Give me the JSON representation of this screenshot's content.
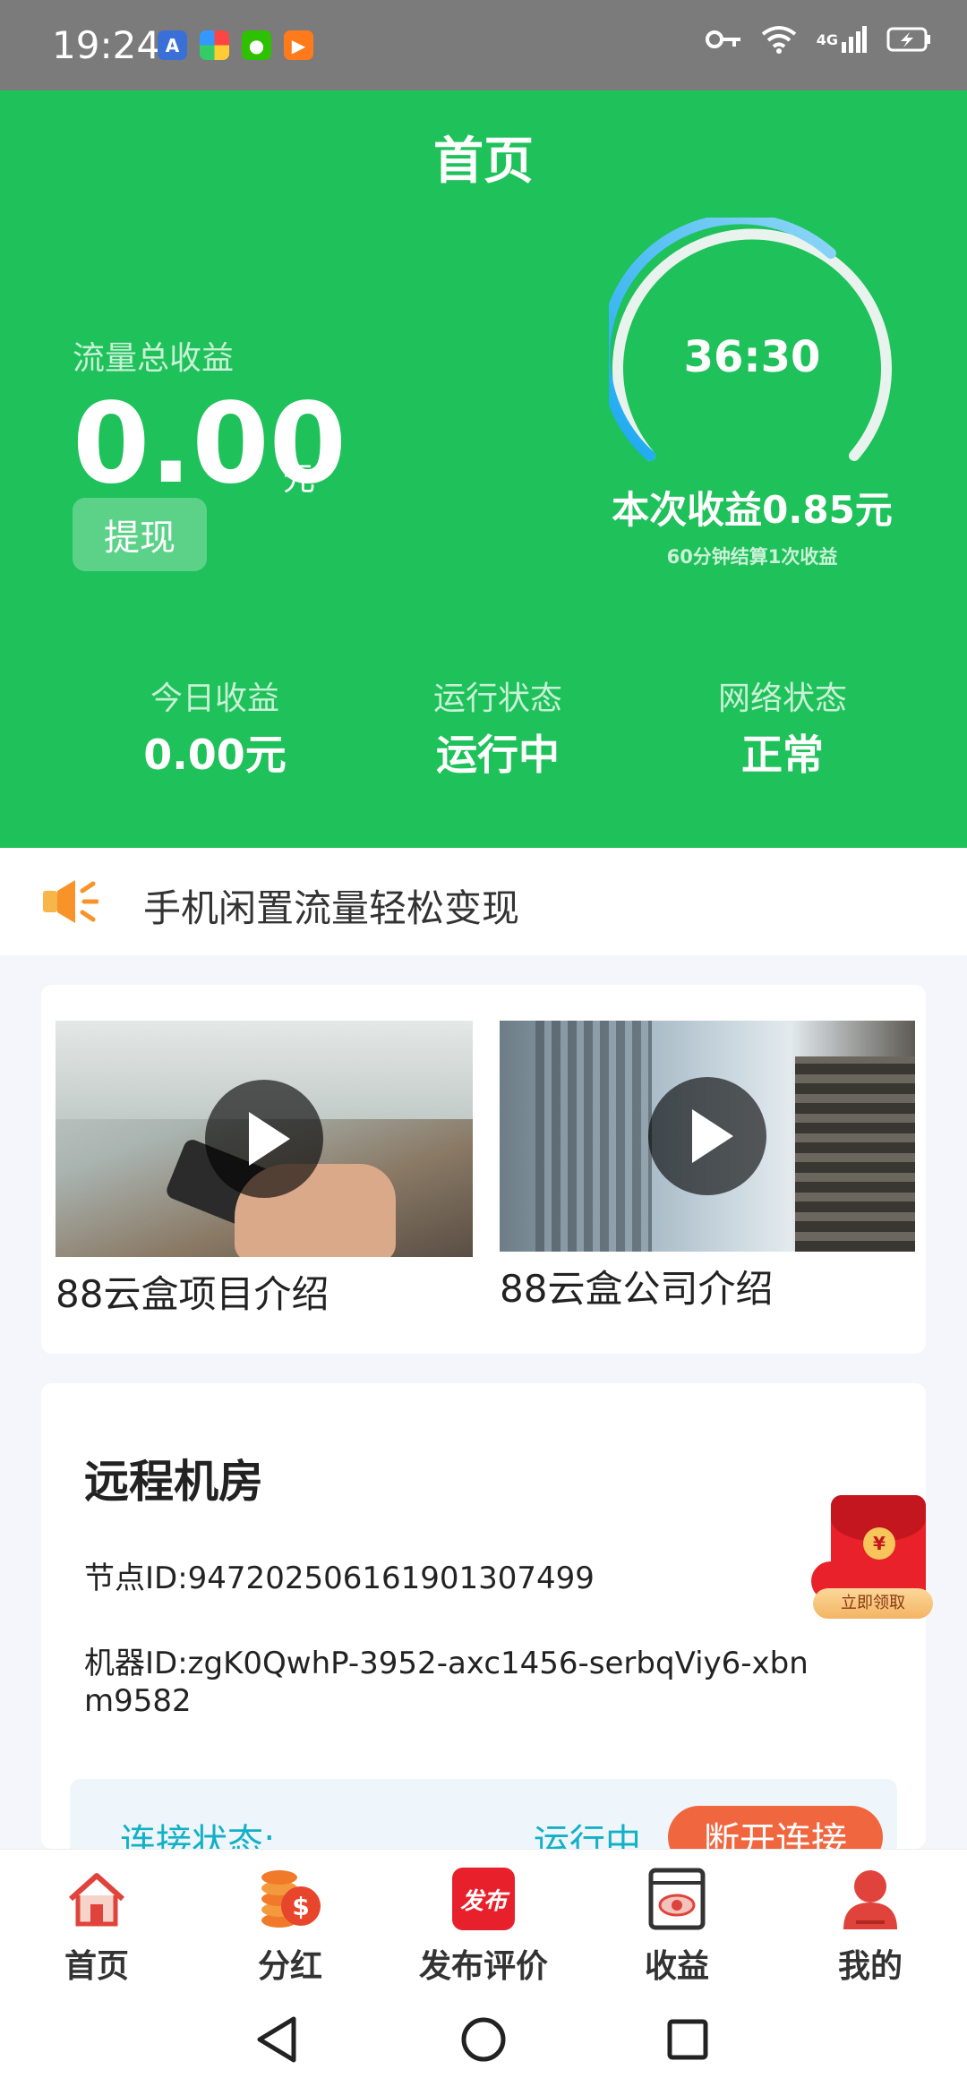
{
  "status_bar": {
    "time": "19:24",
    "network": "4G",
    "icons": [
      "accessibility-icon",
      "colorful-app-icon",
      "wechat-icon",
      "video-app-icon",
      "key-icon",
      "wifi-icon",
      "signal-icon",
      "battery-icon"
    ]
  },
  "header": {
    "title": "首页",
    "total_label": "流量总收益",
    "total_value": "0.00",
    "total_unit": "元",
    "withdraw_label": "提现",
    "timer": "36:30",
    "session_earnings": "本次收益0.85元",
    "settlement_note": "60分钟结算1次收益",
    "stats": [
      {
        "label": "今日收益",
        "value": "0.00元"
      },
      {
        "label": "运行状态",
        "value": "运行中"
      },
      {
        "label": "网络状态",
        "value": "正常"
      }
    ],
    "colors": {
      "background": "#1ec15a",
      "gauge_start": "#18a8f0",
      "gauge_end": "#8fd6f6"
    }
  },
  "notice": {
    "text": "手机闲置流量轻松变现"
  },
  "videos": [
    {
      "caption": "88云盒项目介绍"
    },
    {
      "caption": "88云盒公司介绍"
    }
  ],
  "machine": {
    "title": "远程机房",
    "node_id": "节点ID:947202506161901307499",
    "machine_id": "机器ID:zgK0QwhP-3952-axc1456-serbqViy6-xbnm9582",
    "connection_label": "连接状态:",
    "connection_value": "运行中",
    "disconnect_label": "断开连接"
  },
  "red_packet": {
    "label": "立即领取",
    "symbol": "¥"
  },
  "tabs": [
    {
      "label": "首页",
      "icon": "home-icon"
    },
    {
      "label": "分红",
      "icon": "coins-icon"
    },
    {
      "label": "发布评价",
      "icon": "publish-icon",
      "icon_text": "发布"
    },
    {
      "label": "收益",
      "icon": "earnings-icon"
    },
    {
      "label": "我的",
      "icon": "profile-icon"
    }
  ]
}
